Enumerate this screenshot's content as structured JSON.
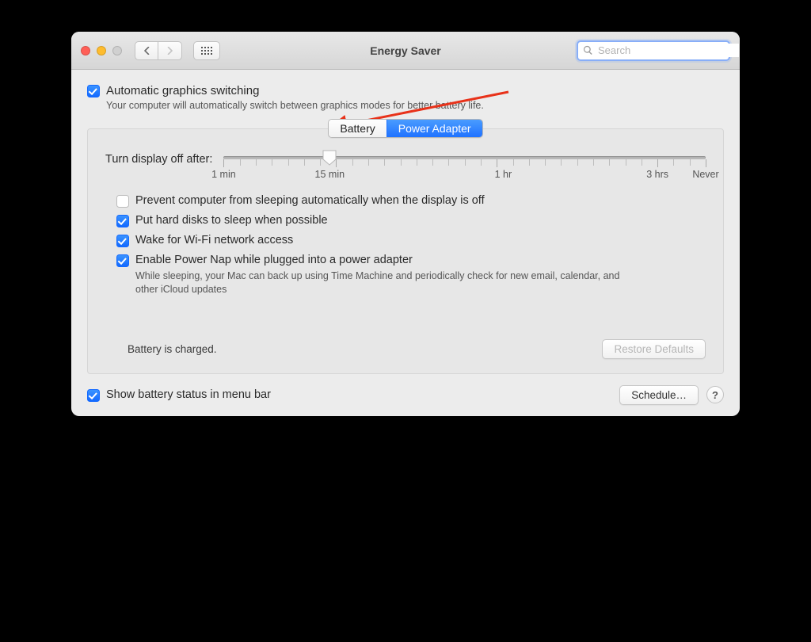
{
  "titlebar": {
    "title": "Energy Saver",
    "search_placeholder": "Search"
  },
  "header": {
    "checkbox_label": "Automatic graphics switching",
    "description": "Your computer will automatically switch between graphics modes for better battery life."
  },
  "tabs": {
    "battery": "Battery",
    "power_adapter": "Power Adapter",
    "active": "power_adapter"
  },
  "slider": {
    "label": "Turn display off after:",
    "labels": {
      "min1": "1 min",
      "min15": "15 min",
      "hr1": "1 hr",
      "hrs3": "3 hrs",
      "never": "Never"
    }
  },
  "options": {
    "prevent_sleep": "Prevent computer from sleeping automatically when the display is off",
    "hard_disks": "Put hard disks to sleep when possible",
    "wake_wifi": "Wake for Wi-Fi network access",
    "power_nap": "Enable Power Nap while plugged into a power adapter",
    "power_nap_desc": "While sleeping, your Mac can back up using Time Machine and periodically check for new email, calendar, and other iCloud updates"
  },
  "panel_footer": {
    "status": "Battery is charged.",
    "restore_defaults": "Restore Defaults"
  },
  "footer": {
    "show_status": "Show battery status in menu bar",
    "schedule": "Schedule…",
    "help": "?"
  }
}
